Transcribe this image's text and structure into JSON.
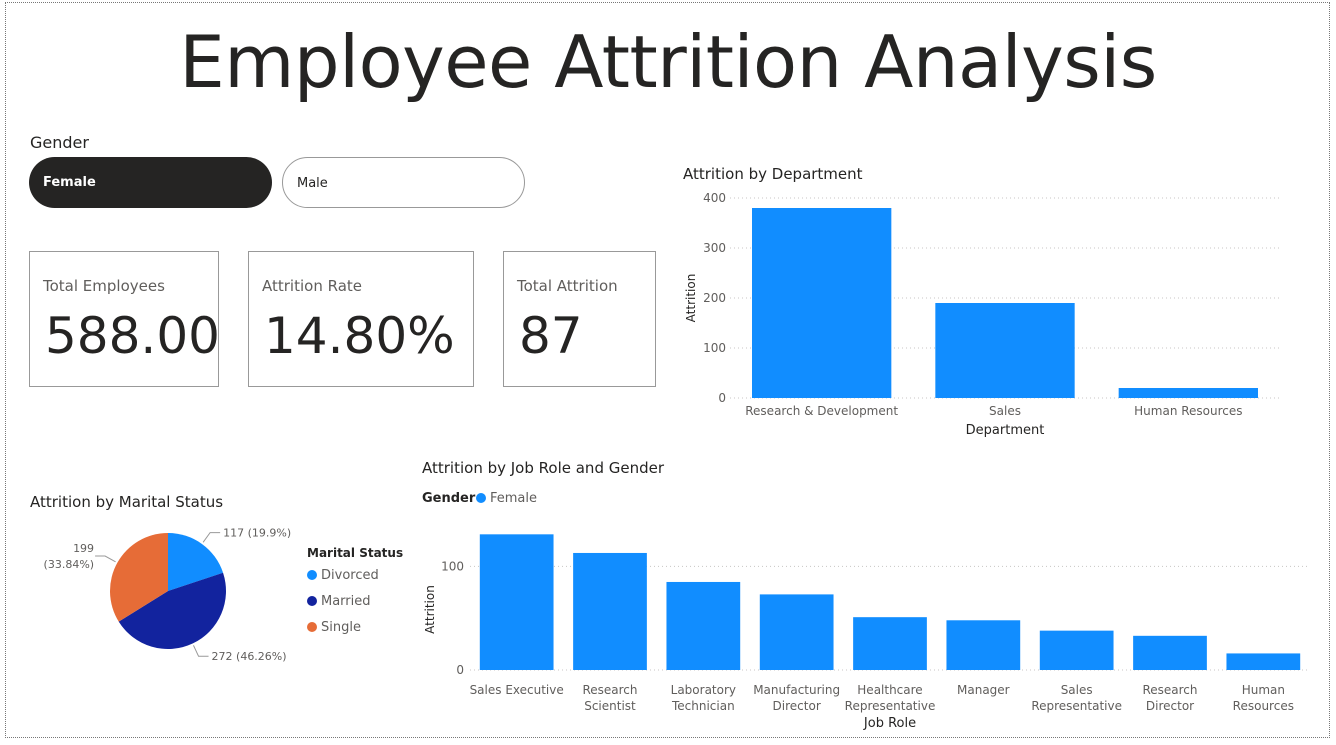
{
  "title": "Employee Attrition Analysis",
  "slicer": {
    "title": "Gender",
    "options": [
      {
        "label": "Female",
        "selected": true
      },
      {
        "label": "Male",
        "selected": false
      }
    ]
  },
  "cards": [
    {
      "label": "Total Employees",
      "value": "588.00"
    },
    {
      "label": "Attrition Rate",
      "value": "14.80%"
    },
    {
      "label": "Total Attrition",
      "value": "87"
    }
  ],
  "colors": {
    "bar": "#118DFF",
    "divorced": "#118DFF",
    "married": "#12239E",
    "single": "#E66C37",
    "text": "#252423",
    "subtext": "#605e5c",
    "grid": "#c8c6c4"
  },
  "chart_data": [
    {
      "type": "bar",
      "title": "Attrition by Department",
      "xlabel": "Department",
      "ylabel": "Attrition",
      "categories": [
        "Research & Development",
        "Sales",
        "Human Resources"
      ],
      "values": [
        380,
        190,
        20
      ],
      "ylim": [
        0,
        400
      ],
      "yticks": [
        0,
        100,
        200,
        300,
        400
      ],
      "grid": true
    },
    {
      "type": "pie",
      "title": "Attrition by Marital Status",
      "legend_title": "Marital Status",
      "categories": [
        "Divorced",
        "Married",
        "Single"
      ],
      "values": [
        117,
        272,
        199
      ],
      "labels": [
        "117 (19.9%)",
        "272 (46.26%)",
        "199 (33.84%)"
      ],
      "legend_position": "right"
    },
    {
      "type": "bar",
      "title": "Attrition by Job Role and Gender",
      "xlabel": "Job Role",
      "ylabel": "Attrition",
      "legend_title": "Gender",
      "legend_position": "top-left",
      "categories": [
        "Sales Executive",
        "Research Scientist",
        "Laboratory Technician",
        "Manufacturing Director",
        "Healthcare Representative",
        "Manager",
        "Sales Representative",
        "Research Director",
        "Human Resources"
      ],
      "tick_lines": [
        [
          "Sales Executive"
        ],
        [
          "Research",
          "Scientist"
        ],
        [
          "Laboratory",
          "Technician"
        ],
        [
          "Manufacturing",
          "Director"
        ],
        [
          "Healthcare",
          "Representative"
        ],
        [
          "Manager"
        ],
        [
          "Sales",
          "Representative"
        ],
        [
          "Research",
          "Director"
        ],
        [
          "Human",
          "Resources"
        ]
      ],
      "series": [
        {
          "name": "Female",
          "values": [
            131,
            113,
            85,
            73,
            51,
            48,
            38,
            33,
            16
          ]
        }
      ],
      "ylim": [
        0,
        140
      ],
      "yticks": [
        0,
        100
      ],
      "grid": true
    }
  ]
}
